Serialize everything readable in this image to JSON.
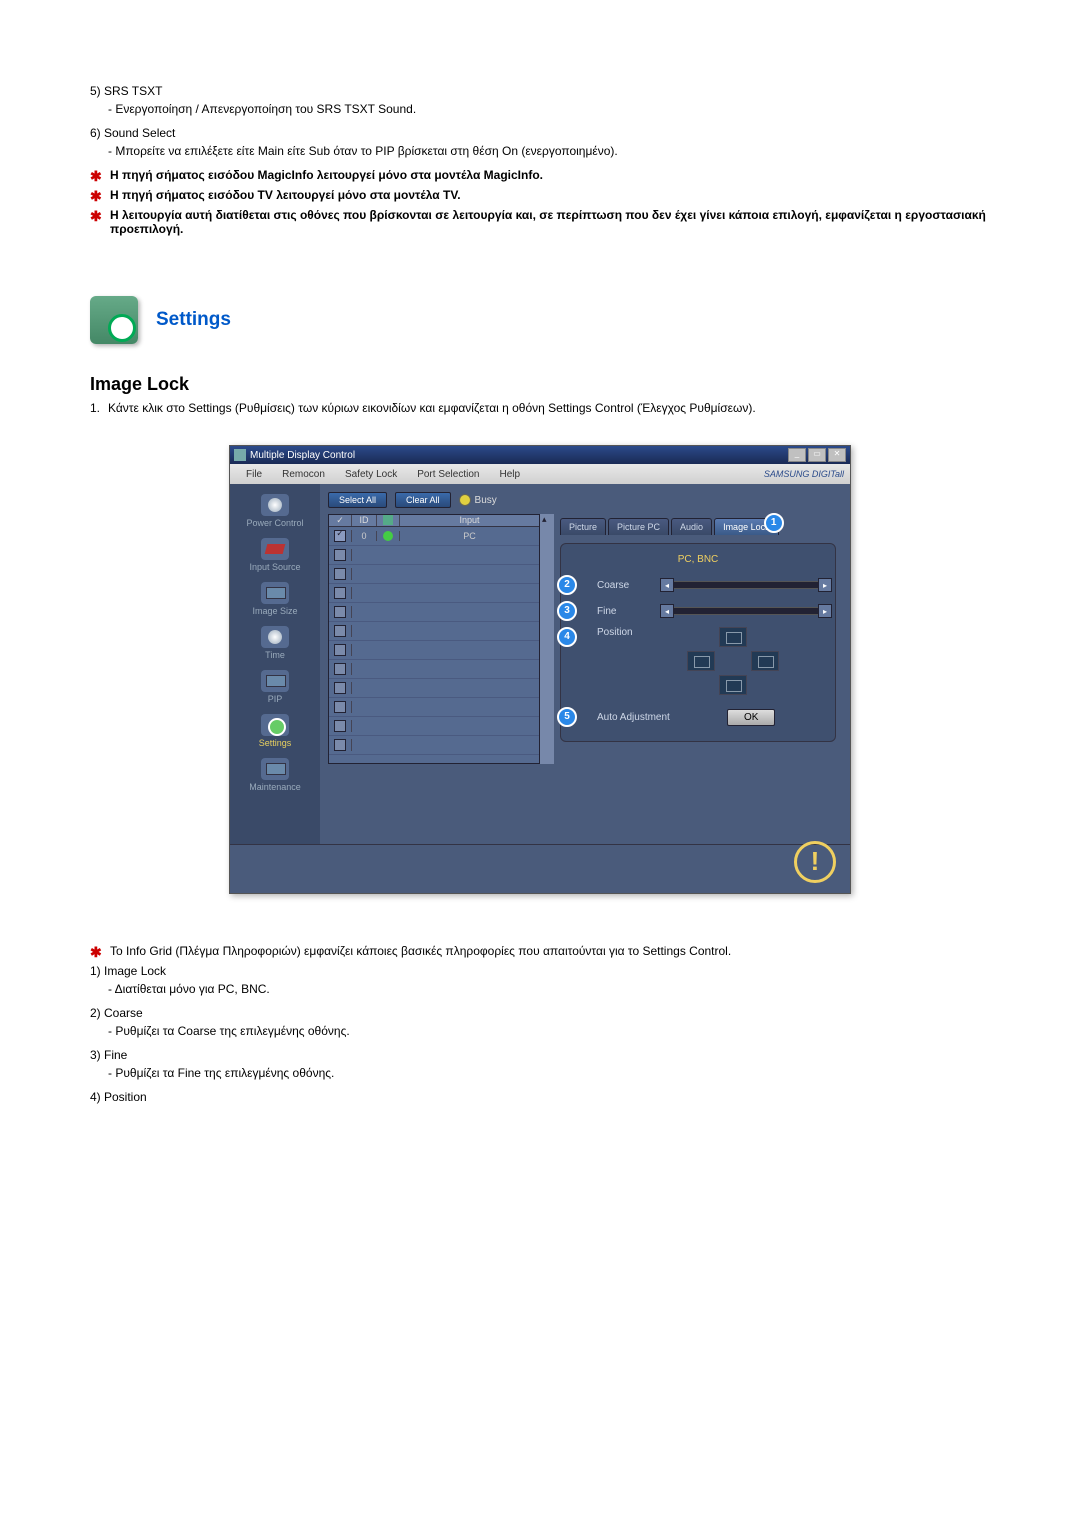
{
  "items": {
    "n5": "5) SRS TSXT",
    "n5_desc": "- Ενεργοποίηση / Απενεργοποίηση του SRS TSXT Sound.",
    "n6": "6) Sound Select",
    "n6_desc": "- Μπορείτε να επιλέξετε είτε Main είτε Sub όταν το PIP βρίσκεται στη θέση On (ενεργοποιημένο)."
  },
  "stars": {
    "s1": "Η πηγή σήματος εισόδου MagicInfo λειτουργεί μόνο στα μοντέλα MagicInfo.",
    "s2": "Η πηγή σήματος εισόδου TV λειτουργεί μόνο στα μοντέλα TV.",
    "s3": "Η λειτουργία αυτή διατίθεται στις οθόνες που βρίσκονται σε λειτουργία και, σε περίπτωση που δεν έχει γίνει κάποια επιλογή, εμφανίζεται η εργοστασιακή προεπιλογή."
  },
  "settings_header": "Settings",
  "section_title": "Image Lock",
  "step1_num": "1.",
  "step1": "Κάντε κλικ στο Settings (Ρυθμίσεις) των κύριων εικονιδίων και εμφανίζεται η οθόνη Settings Control (Έλεγχος Ρυθμίσεων).",
  "app": {
    "title": "Multiple Display Control",
    "menus": [
      "File",
      "Remocon",
      "Safety Lock",
      "Port Selection",
      "Help"
    ],
    "brand": "SAMSUNG DIGITall",
    "select_all": "Select All",
    "clear_all": "Clear All",
    "busy": "Busy",
    "sidebar": [
      "Power Control",
      "Input Source",
      "Image Size",
      "Time",
      "PIP",
      "Settings",
      "Maintenance"
    ],
    "grid_headers": {
      "chk": "✓",
      "id": "ID",
      "st": "",
      "input": "Input"
    },
    "grid_row0": {
      "id": "0",
      "input": "PC"
    },
    "tabs": {
      "picture": "Picture",
      "picture_pc": "Picture PC",
      "audio": "Audio",
      "image_lock": "Image Lock"
    },
    "panel_title": "PC, BNC",
    "coarse": "Coarse",
    "fine": "Fine",
    "position": "Position",
    "auto_adj": "Auto Adjustment",
    "ok": "OK",
    "badges": {
      "b1": "1",
      "b2": "2",
      "b3": "3",
      "b4": "4",
      "b5": "5"
    }
  },
  "bottom_star": "Το Info Grid (Πλέγμα Πληροφοριών) εμφανίζει κάποιες βασικές πληροφορίες που απαιτούνται για το Settings Control.",
  "bottom": {
    "n1": "1) Image Lock",
    "n1d": "- Διατίθεται μόνο για PC, BNC.",
    "n2": "2) Coarse",
    "n2d": "- Ρυθμίζει τα Coarse της επιλεγμένης οθόνης.",
    "n3": "3) Fine",
    "n3d": "- Ρυθμίζει τα Fine της επιλεγμένης οθόνης.",
    "n4": "4) Position"
  }
}
